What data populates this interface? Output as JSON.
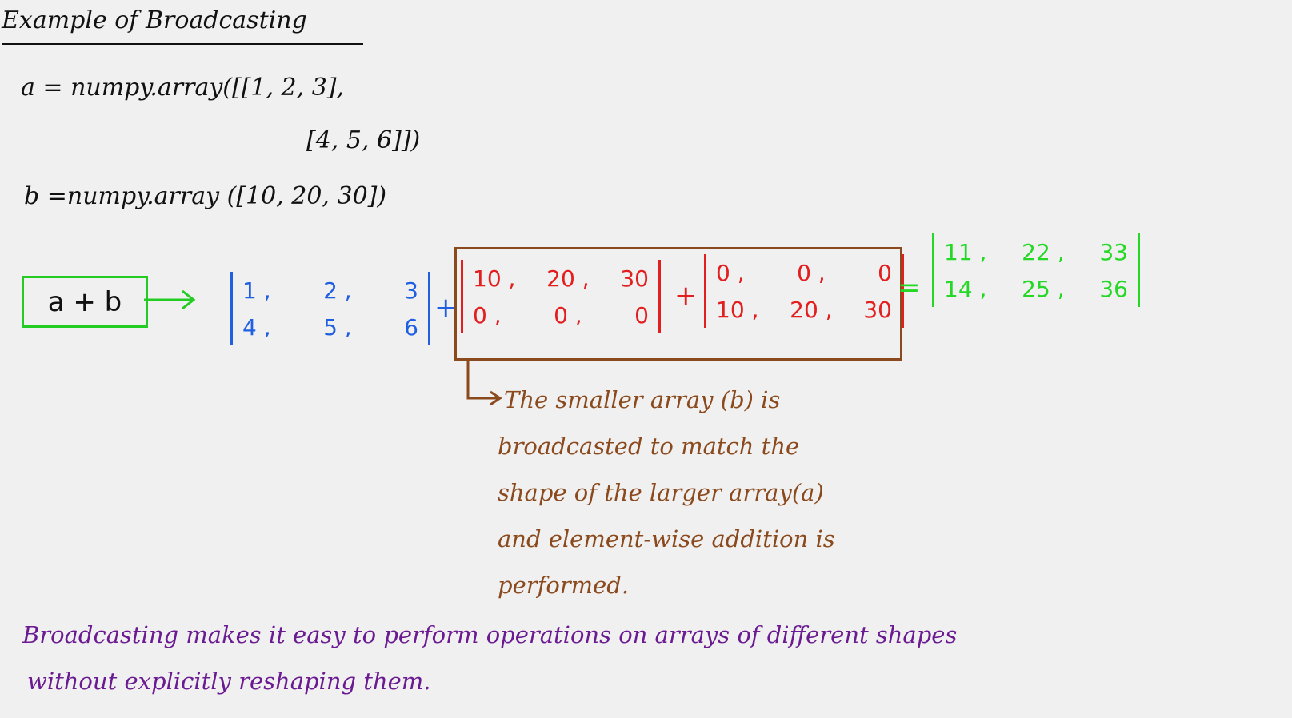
{
  "title": "Example of Broadcasting",
  "code": {
    "line_a1": "a = numpy.array([[1, 2, 3],",
    "line_a2": "[4, 5, 6]])",
    "line_b": "b =numpy.array ([10, 20, 30])"
  },
  "expression": {
    "label": "a + b",
    "matrix_a": [
      [
        "1 ,",
        "2 ,",
        "3"
      ],
      [
        "4 ,",
        "5 ,",
        "6"
      ]
    ],
    "plus": "+",
    "matrix_b1": [
      [
        "10 ,",
        "20 ,",
        "30"
      ],
      [
        "0 ,",
        "0 ,",
        "0"
      ]
    ],
    "matrix_b2": [
      [
        "0 ,",
        "0 ,",
        "0"
      ],
      [
        "10 ,",
        "20 ,",
        "30"
      ]
    ],
    "equals": "=",
    "matrix_result": [
      [
        "11 ,",
        "22 ,",
        "33"
      ],
      [
        "14 ,",
        "25 ,",
        "36"
      ]
    ]
  },
  "note": [
    "The smaller array (b) is",
    "broadcasted  to match the",
    "shape of the larger array(a)",
    "and element-wise addition is",
    "performed."
  ],
  "footer": [
    "Broadcasting makes it easy to perform operations on arrays of different shapes",
    "without explicitly reshaping them."
  ],
  "colors": {
    "matrix_a": "#1f5fe0",
    "matrix_b": "#e21e1e",
    "result": "#26d826",
    "note": "#8b4a1e",
    "footer": "#6b1b91"
  }
}
